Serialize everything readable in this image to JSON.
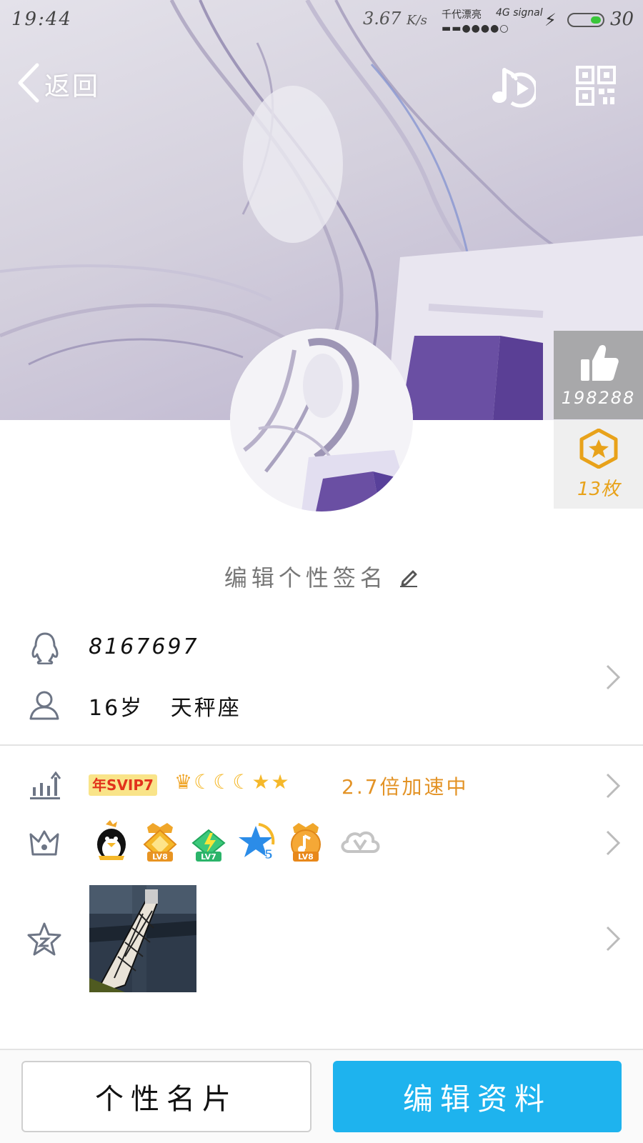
{
  "status_bar": {
    "time": "19:44",
    "speed": "3.67",
    "speed_unit": "K/s",
    "carrier": "千代漂亮",
    "network": "4G signal",
    "battery": "30"
  },
  "nav": {
    "back_label": "返回",
    "music_icon": "music-play-icon",
    "qr_icon": "qr-code-icon"
  },
  "side_panel": {
    "like_count": "198288",
    "badge_count": "13枚"
  },
  "profile": {
    "signature_prompt": "编辑个性签名",
    "qq_number": "8167697",
    "age_zodiac": "16岁   天秤座"
  },
  "vip": {
    "svip_badge": "年SVIP7",
    "level_icons": [
      "crown",
      "moon",
      "moon",
      "moon",
      "star",
      "star"
    ],
    "speed_text": "2.7倍加速中"
  },
  "medals": [
    {
      "name": "qq-penguin",
      "label": ""
    },
    {
      "name": "crown-medal",
      "label": "LV8"
    },
    {
      "name": "lightning-medal",
      "label": "LV7"
    },
    {
      "name": "star-medal",
      "label": "5"
    },
    {
      "name": "music-medal",
      "label": "LV8"
    },
    {
      "name": "weiyun",
      "label": ""
    }
  ],
  "buttons": {
    "card": "个性名片",
    "edit": "编辑资料"
  },
  "colors": {
    "accent": "#1eb3ee",
    "vip_orange": "#e39326",
    "svip_red": "#e2321c",
    "badge_gold": "#e8a21a"
  }
}
